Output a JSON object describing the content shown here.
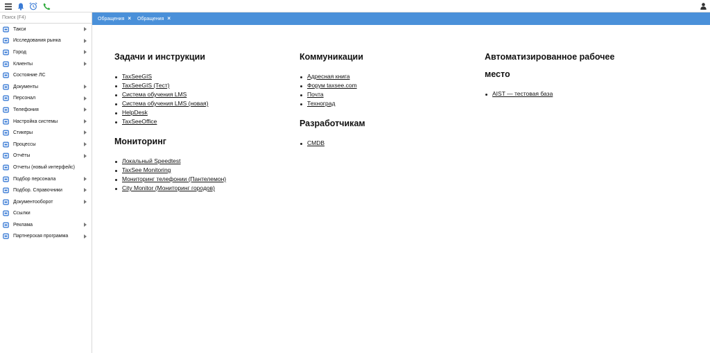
{
  "topbar": {
    "icons": [
      "menu-icon",
      "bell-icon",
      "alarm-clock-icon",
      "phone-icon",
      "user-icon"
    ]
  },
  "sidebar": {
    "search_placeholder": "Поиск (F4)",
    "items": [
      {
        "label": "Такси",
        "icon": "car-icon",
        "submenu": true
      },
      {
        "label": "Исследования рынка",
        "icon": "research-icon",
        "submenu": true
      },
      {
        "label": "Город",
        "icon": "city-icon",
        "submenu": true
      },
      {
        "label": "Клиенты",
        "icon": "clients-icon",
        "submenu": true
      },
      {
        "label": "Состояние ЛС",
        "icon": "document-icon",
        "submenu": false
      },
      {
        "label": "Документы",
        "icon": "documents-icon",
        "submenu": true
      },
      {
        "label": "Персонал",
        "icon": "staff-icon",
        "submenu": true
      },
      {
        "label": "Телефония",
        "icon": "phone-icon",
        "submenu": true
      },
      {
        "label": "Настройка системы",
        "icon": "gear-icon",
        "submenu": true
      },
      {
        "label": "Стикеры",
        "icon": "sticker-icon",
        "submenu": true
      },
      {
        "label": "Процессы",
        "icon": "process-icon",
        "submenu": true
      },
      {
        "label": "Отчёты",
        "icon": "reports-icon",
        "submenu": true
      },
      {
        "label": "Отчеты (новый интерфейс)",
        "icon": "reports-new-icon",
        "submenu": false
      },
      {
        "label": "Подбор персонала",
        "icon": "search-person-icon",
        "submenu": true
      },
      {
        "label": "Подбор. Справочники",
        "icon": "directory-icon",
        "submenu": true
      },
      {
        "label": "Документооборот",
        "icon": "docflow-icon",
        "submenu": true
      },
      {
        "label": "Ссылки",
        "icon": "external-link-icon",
        "submenu": false
      },
      {
        "label": "Реклама",
        "icon": "megaphone-icon",
        "submenu": true
      },
      {
        "label": "Партнерская программа",
        "icon": "partner-icon",
        "submenu": true
      }
    ]
  },
  "tabs": [
    {
      "label": "Обращения"
    },
    {
      "label": "Обращения"
    }
  ],
  "colors": {
    "accent": "#4a90d9",
    "icon_blue": "#3a7bd5",
    "phone_green": "#2eaa3c"
  },
  "sections": {
    "tasks": {
      "title": "Задачи и инструкции",
      "links": [
        "TaxSeeGIS",
        "TaxSeeGIS (Тест)",
        "Система обучения LMS",
        "Система обучения LMS (новая)",
        "HelpDesk",
        "TaxSeeOffice"
      ]
    },
    "monitoring": {
      "title": "Мониторинг",
      "links": [
        "Локальный Speedtest",
        "TaxSee Monitoring",
        "Мониторинг телефонии (Пантелемон)",
        "City Monitor (Мониторинг городов)"
      ]
    },
    "communications": {
      "title": "Коммуникации",
      "links": [
        "Адресная книга",
        "Форум taxsee.com",
        "Почта",
        "Техноград"
      ]
    },
    "developers": {
      "title": "Разработчикам",
      "links": [
        "CMDB"
      ]
    },
    "arm": {
      "title_line1": "Автоматизированное рабочее",
      "title_line2": "место",
      "links": [
        "AIST — тестовая база"
      ]
    }
  }
}
